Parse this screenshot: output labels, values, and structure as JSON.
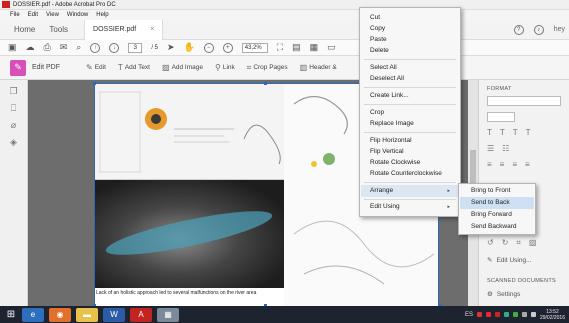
{
  "window": {
    "title": "DOSSIER.pdf - Adobe Acrobat Pro DC"
  },
  "menubar": [
    "File",
    "Edit",
    "View",
    "Window",
    "Help"
  ],
  "tabs": {
    "home": "Home",
    "tools": "Tools",
    "document": "DOSSIER.pdf",
    "close": "×",
    "user": "hey"
  },
  "toolbar": {
    "page_current": "3",
    "page_total": "/ 5",
    "zoom": "43,2%"
  },
  "edit_toolbar": {
    "label": "Edit PDF",
    "tools": [
      "Edit",
      "Add Text",
      "Add Image",
      "Link",
      "Crop Pages",
      "Header &"
    ]
  },
  "document": {
    "caption": "Lack of an holistic approach led to several malfunctions on the river area"
  },
  "context_menu": {
    "items": [
      "Cut",
      "Copy",
      "Paste",
      "Delete",
      "Select All",
      "Deselect All",
      "Create Link...",
      "Crop",
      "Replace Image",
      "Flip Horizontal",
      "Flip Vertical",
      "Rotate Clockwise",
      "Rotate Counterclockwise",
      "Arrange",
      "Edit Using"
    ]
  },
  "submenu": {
    "items": [
      "Bring to Front",
      "Send to Back",
      "Bring Forward",
      "Send Backward"
    ],
    "active": "Send to Back"
  },
  "right_panel": {
    "format_heading": "FORMAT",
    "edit_using": "Edit Using...",
    "scanned_heading": "SCANNED DOCUMENTS",
    "settings": "Settings"
  },
  "taskbar": {
    "lang": "ES",
    "time": "13:52",
    "date": "29/02/2016"
  },
  "colors": {
    "accent": "#2a68c6",
    "edit_pdf_icon": "#d84fb5",
    "taskbar": "#1e2330",
    "highlight": "#cfe0f4"
  },
  "icons": [
    "save-icon",
    "upload-icon",
    "print-icon",
    "mail-icon",
    "search-icon",
    "prev-page-icon",
    "next-page-icon",
    "select-icon",
    "hand-icon",
    "zoom-out-icon",
    "zoom-in-icon",
    "help-icon",
    "bell-icon"
  ]
}
